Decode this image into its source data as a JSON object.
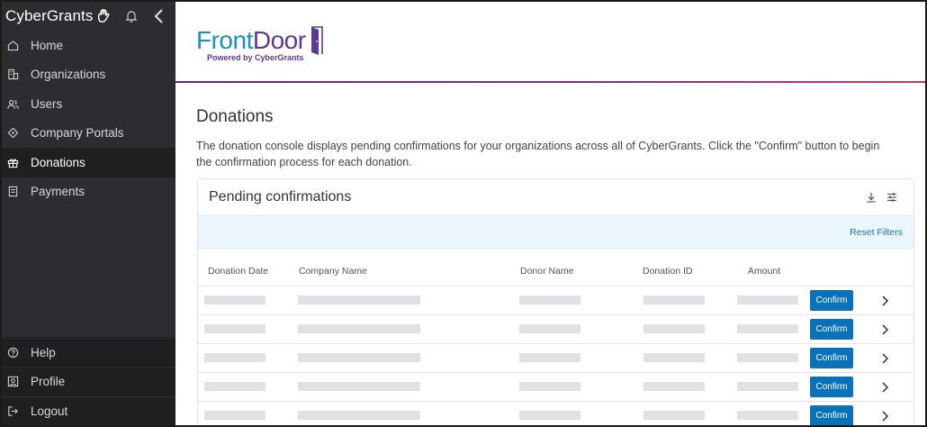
{
  "sidebar": {
    "brand": "CyberGrants",
    "items": [
      {
        "label": "Home",
        "icon": "home-icon"
      },
      {
        "label": "Organizations",
        "icon": "building-icon"
      },
      {
        "label": "Users",
        "icon": "users-icon"
      },
      {
        "label": "Company Portals",
        "icon": "diamond-icon"
      },
      {
        "label": "Donations",
        "icon": "gift-icon",
        "active": true
      },
      {
        "label": "Payments",
        "icon": "receipt-icon"
      }
    ],
    "bottom_items": [
      {
        "label": "Help",
        "icon": "help-icon"
      },
      {
        "label": "Profile",
        "icon": "profile-icon"
      },
      {
        "label": "Logout",
        "icon": "logout-icon"
      }
    ]
  },
  "logo": {
    "front": "Front",
    "door": "Door",
    "tagline": "Powered by CyberGrants"
  },
  "page": {
    "title": "Donations",
    "description": "The donation console displays pending confirmations for your organizations across all of CyberGrants. Click the \"Confirm\" button to begin the confirmation process for each donation."
  },
  "card": {
    "title": "Pending confirmations",
    "reset_filters": "Reset Filters",
    "columns": [
      "Donation Date",
      "Company Name",
      "Donor Name",
      "Donation ID",
      "Amount"
    ],
    "confirm_label": "Confirm",
    "row_count": 5
  },
  "colors": {
    "sidebar_bg": "#2b2d30",
    "accent_blue": "#0a72b8",
    "brand_purple": "#5b3a95"
  }
}
